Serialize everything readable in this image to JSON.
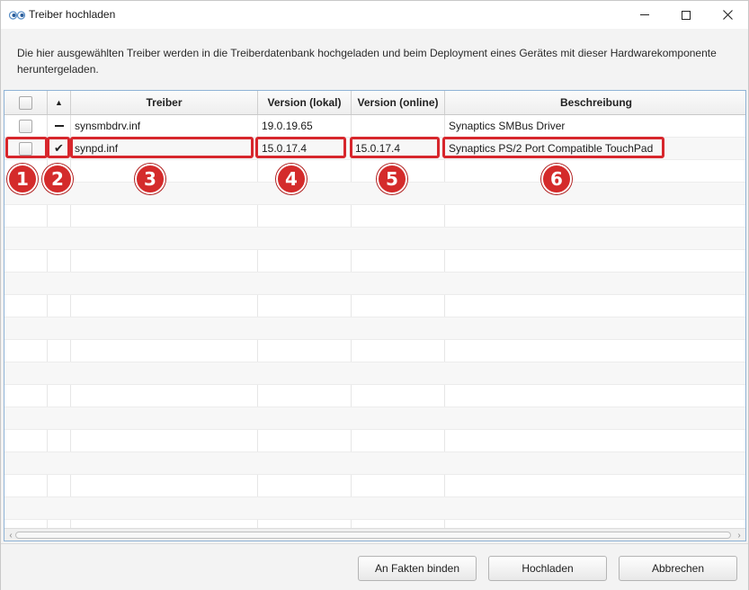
{
  "window": {
    "title": "Treiber hochladen"
  },
  "description": "Die hier ausgewählten Treiber werden in die Treiberdatenbank hochgeladen und beim Deployment eines Gerätes mit dieser Hardwarekomponente heruntergeladen.",
  "table": {
    "sort_indicator": "▲",
    "columns": [
      "Treiber",
      "Version (lokal)",
      "Version (online)",
      "Beschreibung"
    ],
    "rows": [
      {
        "status": "—",
        "driver": "synsmbdrv.inf",
        "version_local": "19.0.19.65",
        "version_online": "",
        "description": "Synaptics SMBus Driver"
      },
      {
        "status": "✔",
        "driver": "synpd.inf",
        "version_local": "15.0.17.4",
        "version_online": "15.0.17.4",
        "description": "Synaptics PS/2 Port Compatible TouchPad"
      }
    ]
  },
  "annotations": [
    "1",
    "2",
    "3",
    "4",
    "5",
    "6"
  ],
  "buttons": {
    "bind": "An Fakten binden",
    "upload": "Hochladen",
    "cancel": "Abbrechen"
  },
  "colors": {
    "highlight": "#d7262c",
    "badge": "#d42b2b",
    "table_border": "#8fb3d6"
  }
}
